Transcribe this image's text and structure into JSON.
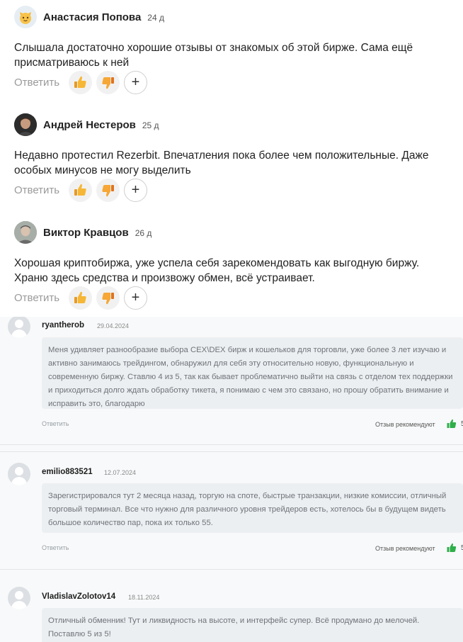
{
  "comments": [
    {
      "author": "Анастасия Попова",
      "date": "24 д",
      "text": "Слышала достаточно хорошие отзывы от знакомых об этой бирже. Сама ещё присматриваюсь к ней",
      "reply_label": "Ответить",
      "avatar_icon": "cat-emoji-icon"
    },
    {
      "author": "Андрей Нестеров",
      "date": "25 д",
      "text": "Недавно протестил Rezerbit. Впечатления пока более чем положительные. Даже особых минусов не могу выделить",
      "reply_label": "Ответить",
      "avatar_icon": "user-photo"
    },
    {
      "author": "Виктор Кравцов",
      "date": "26 д",
      "text": "Хорошая криптобиржа, уже успела себя зарекомендовать как выгодную биржу. Храню здесь средства и произвожу обмен, всё устраивает.",
      "reply_label": "Ответить",
      "avatar_icon": "user-photo"
    }
  ],
  "reactions": {
    "like_icon": "thumbs-up-icon",
    "dislike_icon": "thumbs-down-icon",
    "add_icon": "plus-icon",
    "add_glyph": "+"
  },
  "reviews": [
    {
      "author": "ryantherob",
      "date": "29.04.2024",
      "text": "Меня удивляет разнообразие выбора CEX\\DEX бирж и кошельков для торговли, уже более 3 лет изучаю и активно занимаюсь трейдингом, обнаружил для себя эту относительно новую, функциональную и современную биржу. Ставлю 4 из 5, так как бывает проблематично выйти на связь с отделом тех поддержки и приходиться долго ждать обработку тикета, я понимаю с чем это связано, но прошу обратить внимание и исправить это, благодарю",
      "reply_label": "Ответить",
      "recommend_label": "Отзыв рекомендуют",
      "recommend_count": "5"
    },
    {
      "author": "emilio883521",
      "date": "12.07.2024",
      "text": "Зарегистрировался тут 2 месяца назад, торгую на споте, быстрые транзакции, низкие комиссии, отличный торговый терминал. Все что нужно для различного уровня трейдеров есть, хотелось бы в будущем видеть большое количество пар, пока их только 55.",
      "reply_label": "Ответить",
      "recommend_label": "Отзыв рекомендуют",
      "recommend_count": "5"
    },
    {
      "author": "VladislavZolotov14",
      "date": "18.11.2024",
      "text": "Отличный обменник! Тут и ликвидность на высоте, и интерфейс супер. Всё продумано до мелочей. Поставлю 5 из 5!",
      "reply_label": "",
      "recommend_label": "",
      "recommend_count": ""
    }
  ],
  "colors": {
    "accent_green": "#2eaf4a",
    "like_bg": "#f1f1f1",
    "review_bg": "#f8f9fa"
  }
}
